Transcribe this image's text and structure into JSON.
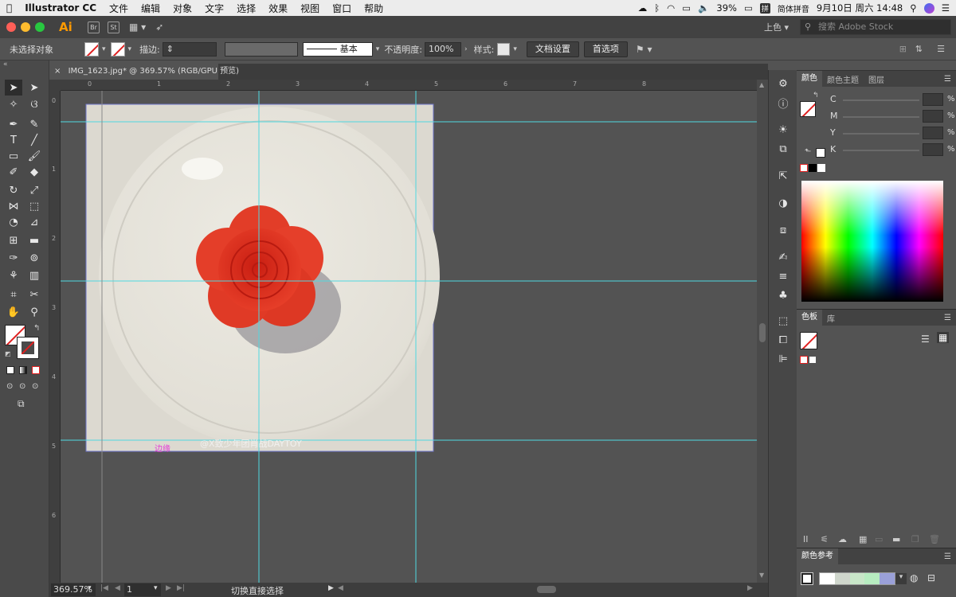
{
  "menubar": {
    "app": "Illustrator CC",
    "items": [
      "文件",
      "编辑",
      "对象",
      "文字",
      "选择",
      "效果",
      "视图",
      "窗口",
      "帮助"
    ],
    "battery": "39%",
    "input_method_badge": "拼",
    "input_method": "简体拼音",
    "clock": "9月10日 周六 14:48"
  },
  "appbar": {
    "logo": "Ai",
    "bridge": "Br",
    "stock": "St",
    "workspace": "上色",
    "search_placeholder": "搜索 Adobe Stock"
  },
  "control": {
    "selection_status": "未选择对象",
    "stroke_label": "描边:",
    "brush_label": "基本",
    "opacity_label": "不透明度:",
    "opacity_value": "100%",
    "style_label": "样式:",
    "doc_setup": "文档设置",
    "preferences": "首选项"
  },
  "document": {
    "tab_title": "IMG_1623.jpg* @ 369.57% (RGB/GPU 预览)",
    "ruler_top": [
      "0",
      "1",
      "2",
      "3",
      "4",
      "5",
      "6",
      "7",
      "8"
    ],
    "ruler_left": [
      "0",
      "1",
      "2",
      "3",
      "4",
      "5",
      "6"
    ],
    "edge_hint": "边缘",
    "watermark": "@X致少年团肖战DAYTOY"
  },
  "status": {
    "zoom": "369.57%",
    "artboard": "1",
    "tool_hint": "切换直接选择"
  },
  "color_panel": {
    "tabs": [
      "颜色",
      "颜色主题",
      "图层"
    ],
    "channels": [
      "C",
      "M",
      "Y",
      "K"
    ],
    "unit": "%"
  },
  "swatches_panel": {
    "tabs": [
      "色板",
      "库"
    ]
  },
  "color_guide": {
    "title": "颜色参考"
  },
  "colors": {
    "guide": "#4fd8e0",
    "accent_orange": "#ff9a00",
    "close": "#ff5f57",
    "minimize": "#febc2e",
    "maximize": "#28c840",
    "flower": "#e0301e"
  }
}
